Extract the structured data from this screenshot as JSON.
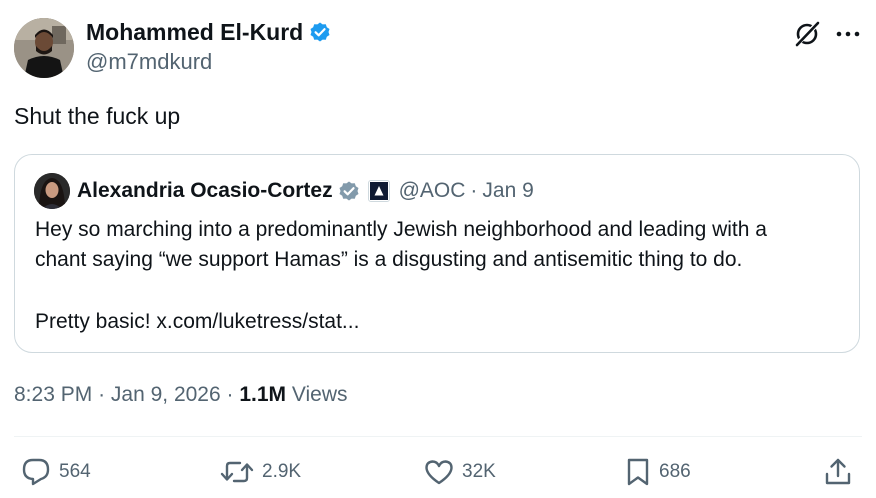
{
  "author": {
    "name": "Mohammed El-Kurd",
    "handle": "@m7mdkurd",
    "verified": true
  },
  "tweet": {
    "text": "Shut the fuck up"
  },
  "quoted_tweet": {
    "name": "Alexandria Ocasio-Cortez",
    "handle": "@AOC",
    "separator": "·",
    "date": "Jan 9",
    "verified": true,
    "lines": [
      "Hey so marching into a predominantly Jewish neighborhood and leading with a",
      "chant saying “we support Hamas” is a disgusting and antisemitic thing to do."
    ],
    "second_paragraph": "Pretty basic! x.com/luketress/stat..."
  },
  "meta": {
    "time": "8:23 PM",
    "separator1": "·",
    "date": "Jan 9, 2026",
    "separator2": "·",
    "views_count": "1.1M",
    "views_label": "Views"
  },
  "actions": {
    "replies": "564",
    "reposts": "2.9K",
    "likes": "32K",
    "bookmarks": "686"
  },
  "icons": {
    "verified": "verified-badge-icon",
    "grok": "grok-icon",
    "more": "more-options-icon",
    "reply": "reply-icon",
    "repost": "repost-icon",
    "like": "heart-icon",
    "bookmark": "bookmark-icon",
    "share": "share-icon",
    "affiliate": "affiliate-badge-icon"
  },
  "colors": {
    "verified_blue": "#1d9bf0",
    "verified_gray": "#829aab",
    "text_primary": "#0f1419",
    "text_secondary": "#536471",
    "border": "#cfd9de"
  }
}
